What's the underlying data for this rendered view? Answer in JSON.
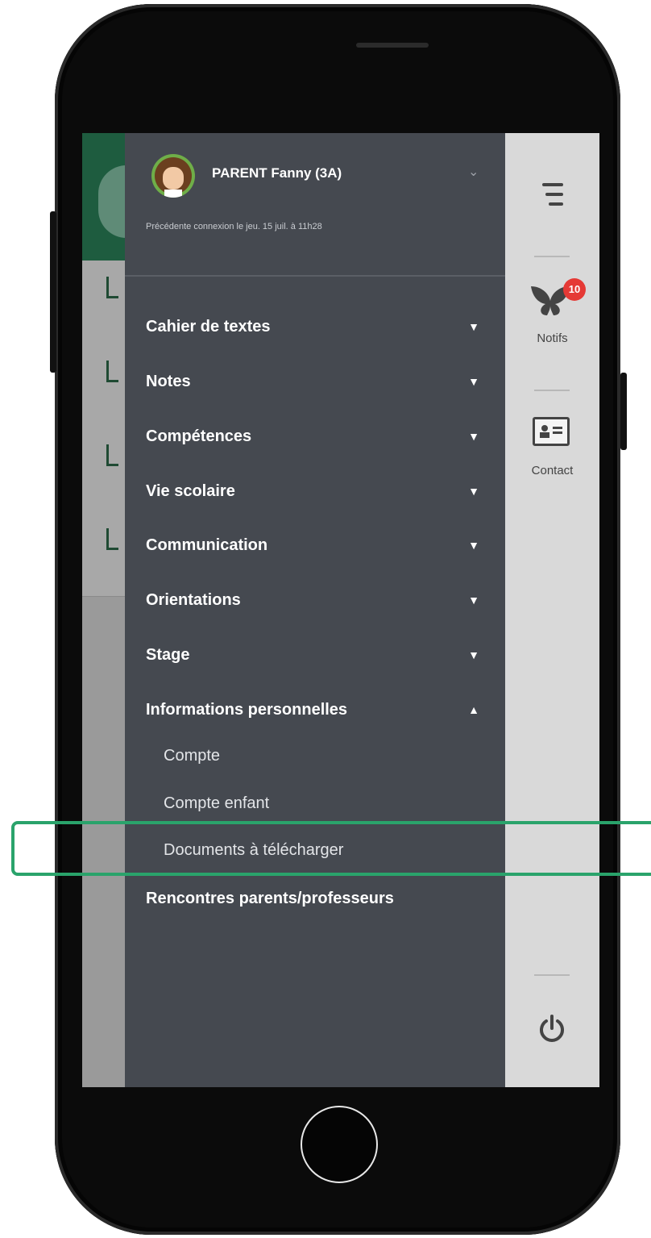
{
  "profile": {
    "name": "PARENT Fanny (3A)",
    "last_login": "Précédente connexion le jeu. 15 juil. à 11h28"
  },
  "menu": {
    "items": [
      {
        "label": "Cahier de textes",
        "chevron": "chevron-down"
      },
      {
        "label": "Notes",
        "chevron": "chevron-down"
      },
      {
        "label": "Compétences",
        "chevron": "chevron-down"
      },
      {
        "label": "Vie scolaire",
        "chevron": "chevron-down"
      },
      {
        "label": "Communication",
        "chevron": "chevron-down"
      },
      {
        "label": "Orientations",
        "chevron": "chevron-down"
      },
      {
        "label": "Stage",
        "chevron": "chevron-down"
      },
      {
        "label": "Informations personnelles",
        "chevron": "chevron-up"
      }
    ],
    "sub_items": [
      {
        "label": "Compte"
      },
      {
        "label": "Compte enfant"
      },
      {
        "label": "Documents à télécharger"
      }
    ],
    "last_item": "Rencontres parents/professeurs"
  },
  "rail": {
    "notifs_label": "Notifs",
    "notifs_count": "10",
    "contact_label": "Contact"
  },
  "colors": {
    "drawer_bg": "#454950",
    "rail_bg": "#d9d9d9",
    "highlight": "#2aa36b",
    "badge": "#e53935"
  }
}
